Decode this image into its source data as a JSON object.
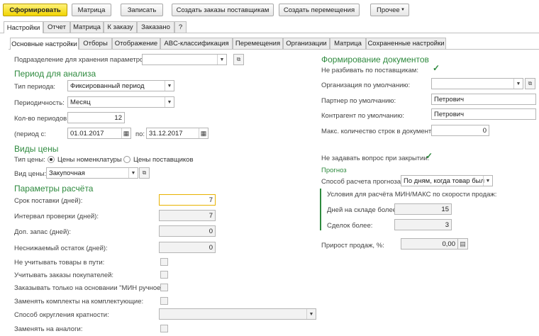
{
  "toolbar": {
    "generate": "Сформировать",
    "matrix": "Матрица",
    "write": "Записать",
    "create_orders": "Создать заказы поставщикам",
    "create_moves": "Создать перемещения",
    "more": "Прочее"
  },
  "tabs": [
    "Настройки",
    "Отчет",
    "Матрица",
    "К заказу",
    "Заказано",
    "?"
  ],
  "subtabs": [
    "Основные настройки",
    "Отборы",
    "Отображение",
    "ABC-классификация",
    "Перемещения",
    "Организации",
    "Матрица",
    "Сохраненные настройки"
  ],
  "left": {
    "storage_label": "Подразделение для хранения параметров:",
    "storage_value": "",
    "period_header": "Период для анализа",
    "period_type_label": "Тип периода:",
    "period_type_value": "Фиксированный период",
    "periodicity_label": "Периодичность:",
    "periodicity_value": "Месяц",
    "periods_count_label": "Кол-во периодов:",
    "periods_count_value": "12",
    "period_from_label": "(период с:",
    "period_from_value": "01.01.2017",
    "period_to_label": "по:",
    "period_to_value": "31.12.2017",
    "price_header": "Виды цены",
    "price_type_label": "Тип цены:",
    "radio_nomenclature": "Цены номенклатуры",
    "radio_suppliers": "Цены поставщиков",
    "price_kind_label": "Вид цены:",
    "price_kind_value": "Закупочная",
    "calc_header": "Параметры расчёта",
    "delivery_label": "Срок поставки (дней):",
    "delivery_value": "7",
    "check_interval_label": "Интервал проверки (дней):",
    "check_interval_value": "7",
    "extra_stock_label": "Доп. запас (дней):",
    "extra_stock_value": "0",
    "min_rest_label": "Неснижаемый остаток (дней):",
    "min_rest_value": "0",
    "no_transit_label": "Не учитывать товары в пути:",
    "customer_orders_label": "Учитывать заказы покупателей:",
    "manual_min_label": "Заказывать только на основании \"МИН ручное\":",
    "replace_kits_label": "Заменять комплекты на комплектующие:",
    "rounding_label": "Способ округления кратности:",
    "rounding_value": "",
    "analogs_label": "Заменять на аналоги:"
  },
  "right": {
    "docs_header": "Формирование документов",
    "no_split_label": "Не разбивать по поставщикам:",
    "org_label": "Организация по умолчанию:",
    "org_value": "",
    "partner_label": "Партнер по умолчанию:",
    "partner_value": "Петрович",
    "contractor_label": "Контрагент по умолчанию:",
    "contractor_value": "Петрович",
    "max_rows_label": "Макс. количество строк в документе:",
    "max_rows_value": "0",
    "no_question_label": "Не задавать вопрос при закрытии:",
    "forecast_header": "Прогноз",
    "forecast_method_label": "Способ расчета прогноза:",
    "forecast_method_value": "По дням, когда товар был",
    "conditions_label": "Условия для расчёта МИН/МАКС по скорости продаж:",
    "days_in_stock_label": "Дней на складе более:",
    "days_in_stock_value": "15",
    "deals_label": "Сделок более:",
    "deals_value": "3",
    "growth_label": "Прирост продаж, %:",
    "growth_value": "0,00"
  },
  "colors": {
    "accent_green": "#2e8a3e",
    "primary_button": "#f1d400"
  },
  "icons": [
    "calendar-icon",
    "chevron-down-icon",
    "open-form-icon",
    "calculator-icon",
    "checkmark-icon"
  ]
}
